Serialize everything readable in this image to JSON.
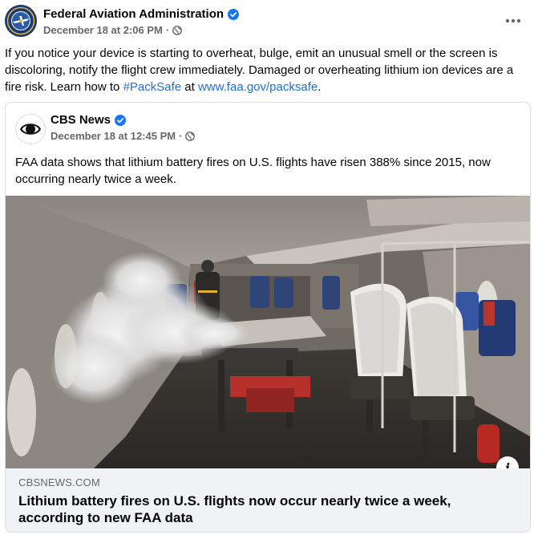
{
  "post": {
    "author": "Federal Aviation Administration",
    "timestamp": "December 18 at 2:06 PM",
    "separator": "·",
    "visibility_icon": "globe-icon",
    "text_before_tag": "If you notice your device is starting to overheat, bulge, emit an unusual smell or the screen is discoloring, notify the flight crew immediately. Damaged or overheating lithium ion devices are a fire risk. Learn how to ",
    "hashtag": "#PackSafe",
    "text_middle": " at ",
    "link": "www.faa.gov/packsafe",
    "text_end": ".",
    "more_icon": "more-horizontal-icon"
  },
  "shared": {
    "author": "CBS News",
    "timestamp": "December 18 at 12:45 PM",
    "separator": "·",
    "text": "FAA data shows that lithium battery fires on U.S. flights have risen 388% since 2015, now occurring nearly twice a week.",
    "info_glyph": "i",
    "link_domain": "CBSNEWS.COM",
    "link_title": "Lithium battery fires on U.S. flights now occur nearly twice a week, according to new FAA data"
  },
  "colors": {
    "link": "#216fdb",
    "verified": "#1877f2",
    "secondary_text": "#65676b",
    "preview_bg": "#f0f2f5"
  }
}
